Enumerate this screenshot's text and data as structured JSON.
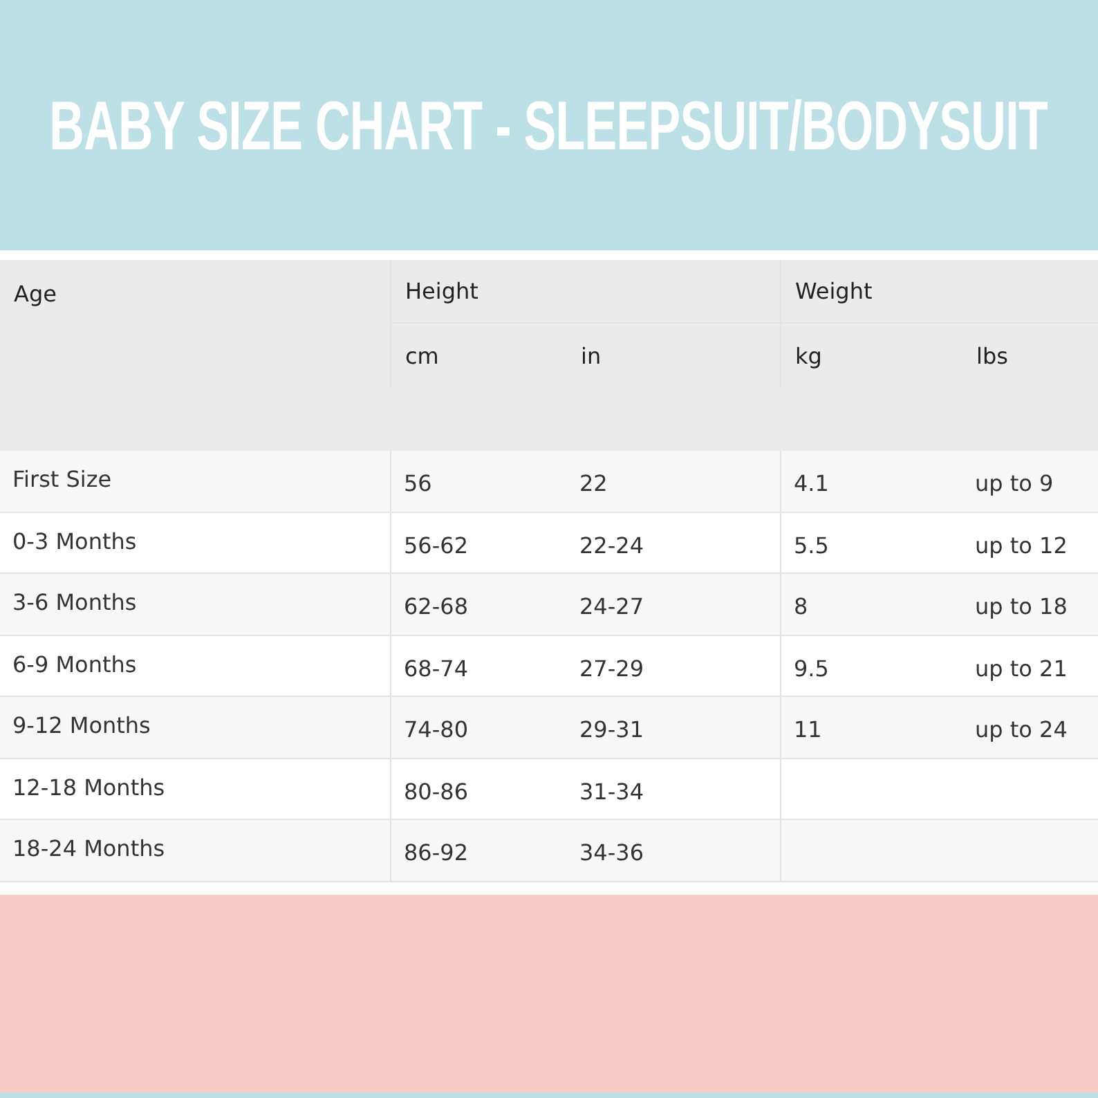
{
  "title": "BABY SIZE CHART - SLEEPSUIT/BODYSUIT",
  "table": {
    "columns": {
      "age": "Age",
      "height": "Height",
      "weight": "Weight",
      "cm": "cm",
      "in": "in",
      "kg": "kg",
      "lbs": "lbs"
    },
    "rows": [
      {
        "age": "First Size",
        "cm": "56",
        "in": "22",
        "kg": "4.1",
        "lbs": "up to 9"
      },
      {
        "age": "0-3 Months",
        "cm": "56-62",
        "in": "22-24",
        "kg": "5.5",
        "lbs": "up to 12"
      },
      {
        "age": "3-6 Months",
        "cm": "62-68",
        "in": "24-27",
        "kg": "8",
        "lbs": "up to 18"
      },
      {
        "age": "6-9 Months",
        "cm": "68-74",
        "in": "27-29",
        "kg": "9.5",
        "lbs": "up to 21"
      },
      {
        "age": "9-12 Months",
        "cm": "74-80",
        "in": "29-31",
        "kg": "11",
        "lbs": "up to 24"
      },
      {
        "age": "12-18 Months",
        "cm": "80-86",
        "in": "31-34"
      },
      {
        "age": "18-24 Months",
        "cm": "86-92",
        "in": "34-36"
      }
    ]
  }
}
